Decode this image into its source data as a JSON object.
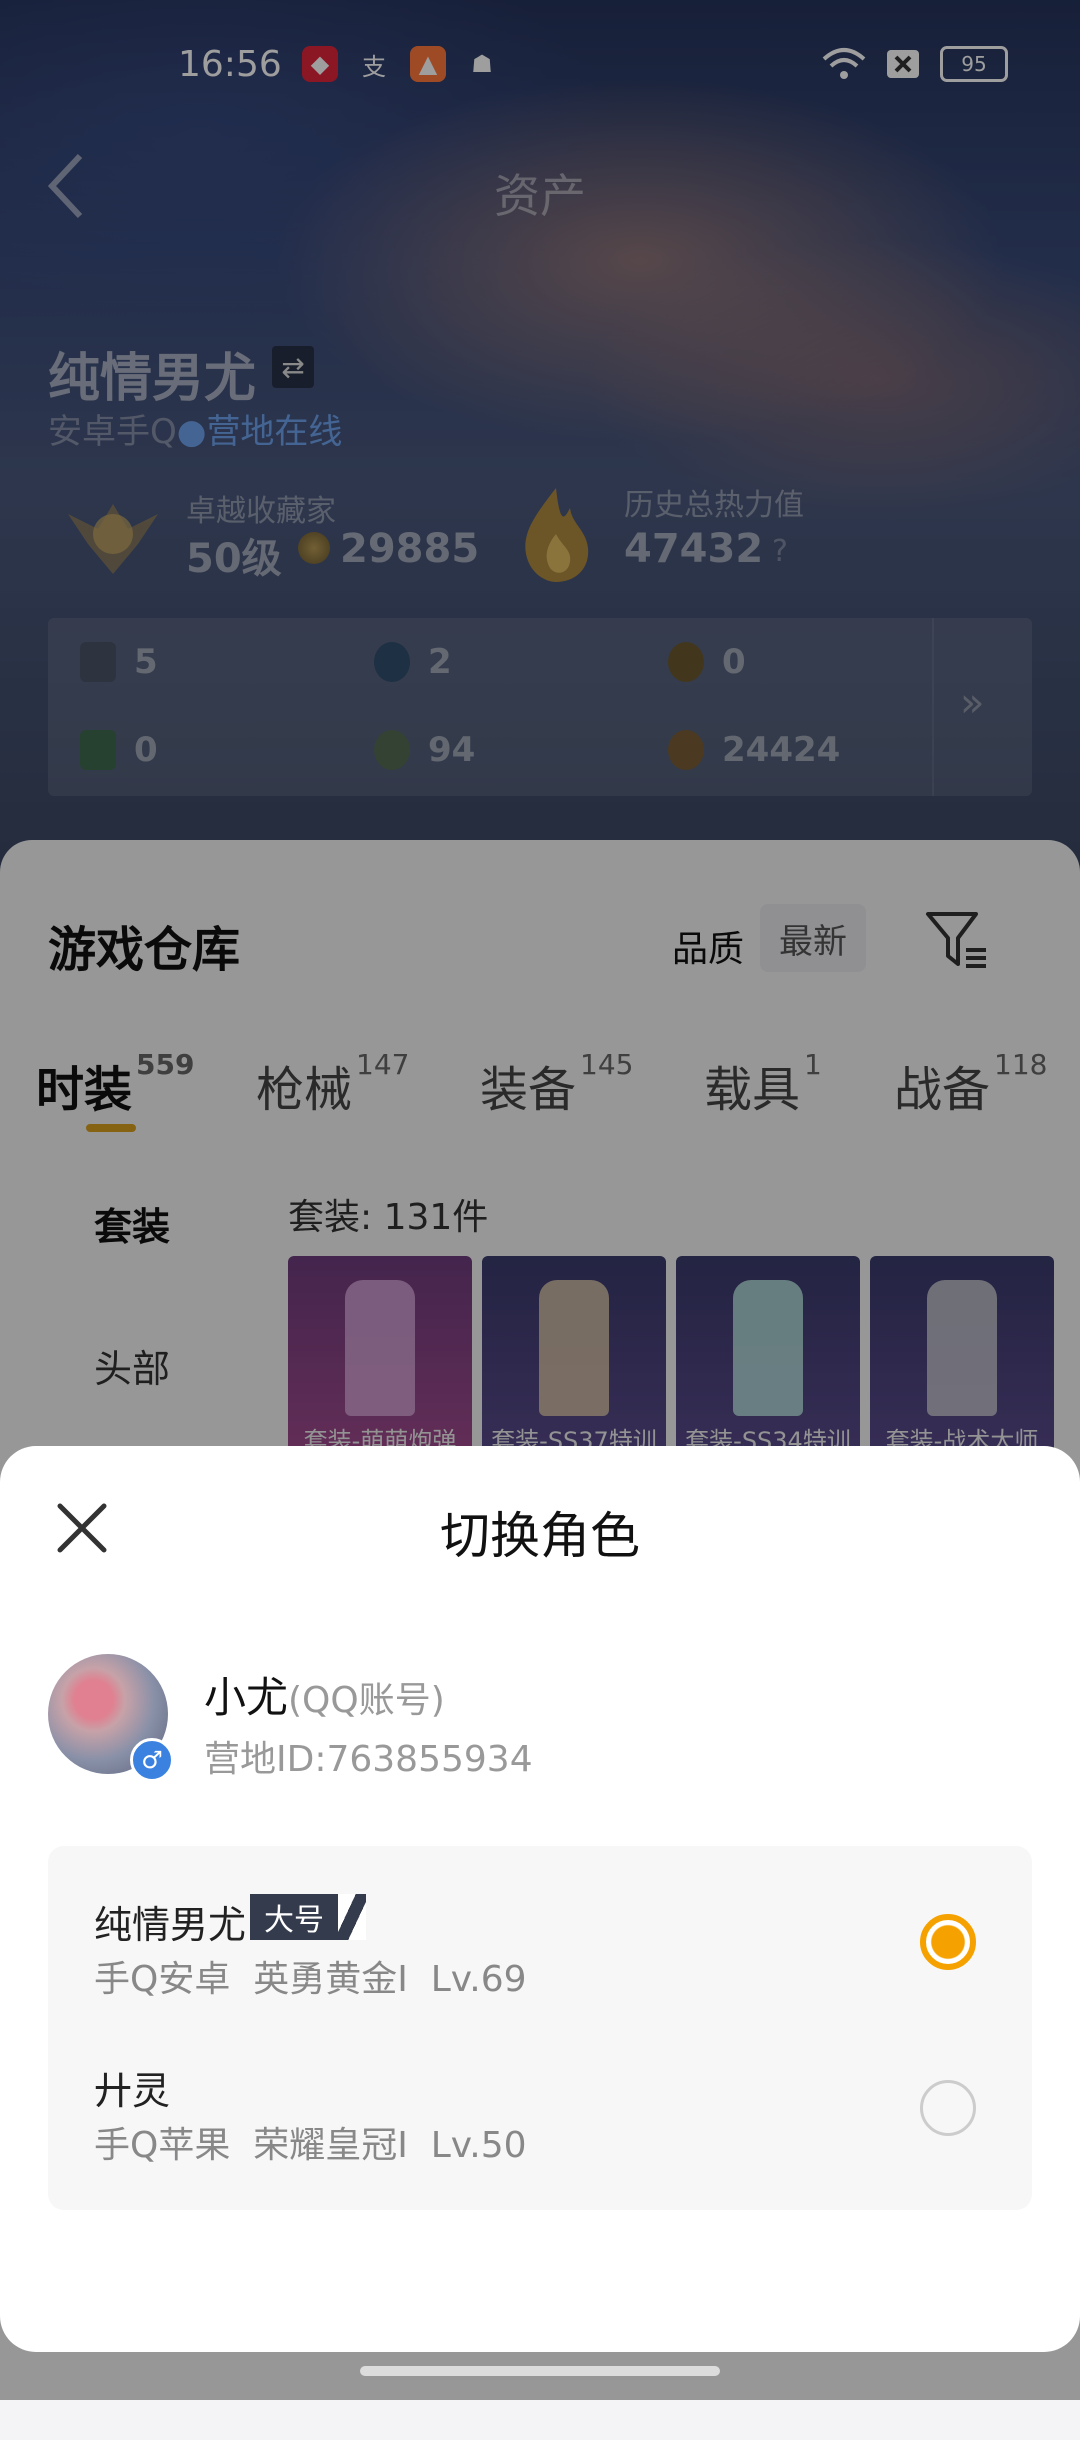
{
  "status_bar": {
    "time": "16:56",
    "battery": "95"
  },
  "header": {
    "title": "资产",
    "player_name": "纯情男尤",
    "platform": "安卓手Q",
    "online_status": "营地在线"
  },
  "collector": {
    "label": "卓越收藏家",
    "level": "50级",
    "points": "29885"
  },
  "heat": {
    "label": "历史总热力值",
    "value": "47432",
    "help": "?"
  },
  "stats": {
    "row1": [
      "5",
      "2",
      "0"
    ],
    "row2": [
      "0",
      "94",
      "24424"
    ],
    "more": "»"
  },
  "warehouse": {
    "title": "游戏仓库",
    "quality": "品质",
    "newest": "最新",
    "tabs": [
      {
        "label": "时装",
        "count": "559"
      },
      {
        "label": "枪械",
        "count": "147"
      },
      {
        "label": "装备",
        "count": "145"
      },
      {
        "label": "载具",
        "count": "1"
      },
      {
        "label": "战备",
        "count": "118"
      }
    ],
    "side": [
      "套装",
      "头部"
    ],
    "suit_count": "套装: 131件",
    "items": [
      "套装-萌萌炮弹",
      "套装-SS37特训",
      "套装-SS34特训",
      "套装-战术大师"
    ]
  },
  "sheet": {
    "title": "切换角色",
    "account_name": "小尤",
    "account_type": "(QQ账号)",
    "account_id": "营地ID:763855934",
    "gender": "♂",
    "roles": [
      {
        "name": "纯情男尤",
        "tag": "大号",
        "info": "手Q安卓  英勇黄金I  Lv.69",
        "selected": true
      },
      {
        "name": "廾灵",
        "info": "手Q苹果  荣耀皇冠I  Lv.50",
        "selected": false
      }
    ]
  },
  "colors": {
    "accent": "#f5a200",
    "online": "#6fa4ee",
    "tab_underline": "#d8a020"
  }
}
